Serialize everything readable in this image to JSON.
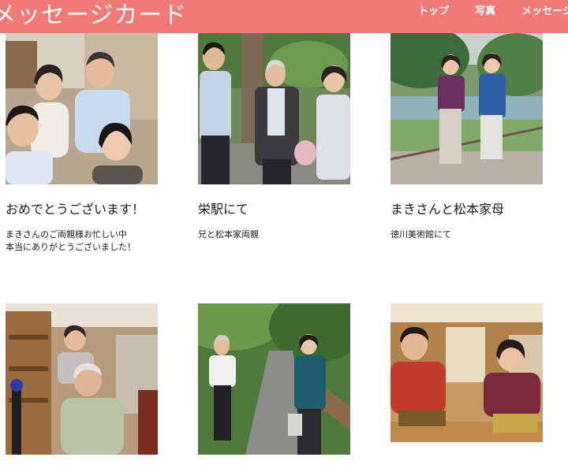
{
  "header": {
    "site_title": "メッセージカード",
    "nav": [
      {
        "label": "トップ"
      },
      {
        "label": "写真"
      },
      {
        "label": "メッセージ"
      }
    ],
    "background_color": "#f27a76"
  },
  "cards": [
    {
      "title": "おめでとうございます！",
      "text": "まきさんのご両親様お忙しい中\n本当にありがとうございました！"
    },
    {
      "title": "栄駅にて",
      "text": "兄と松本家両親"
    },
    {
      "title": "まきさんと松本家母",
      "text": "徳川美術館にて"
    },
    {
      "title": "",
      "text": ""
    },
    {
      "title": "",
      "text": ""
    },
    {
      "title": "",
      "text": ""
    }
  ]
}
